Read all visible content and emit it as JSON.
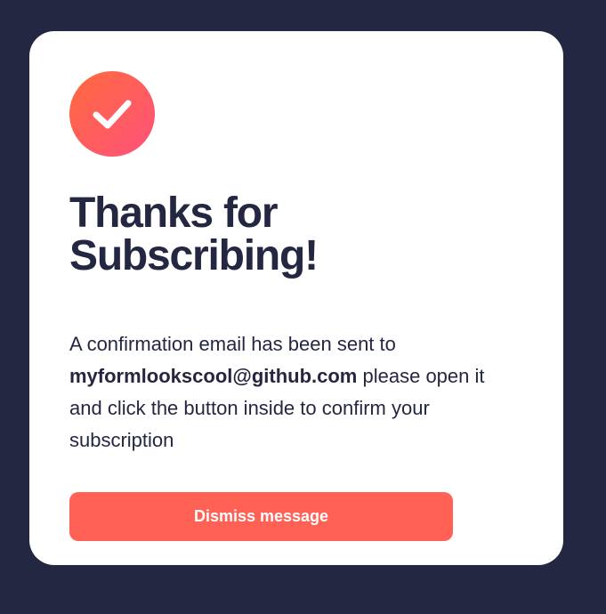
{
  "card": {
    "title": "Thanks for Subscribing!",
    "message_before": "A confirmation email has been sent to",
    "email": "myformlookscool@github.com",
    "message_after": "please open it and click the button inside to confirm your subscription",
    "icon": "checkmark-icon",
    "accent_color": "#ff6155",
    "background_color": "#242742",
    "dismiss_label": "Dismiss message"
  }
}
